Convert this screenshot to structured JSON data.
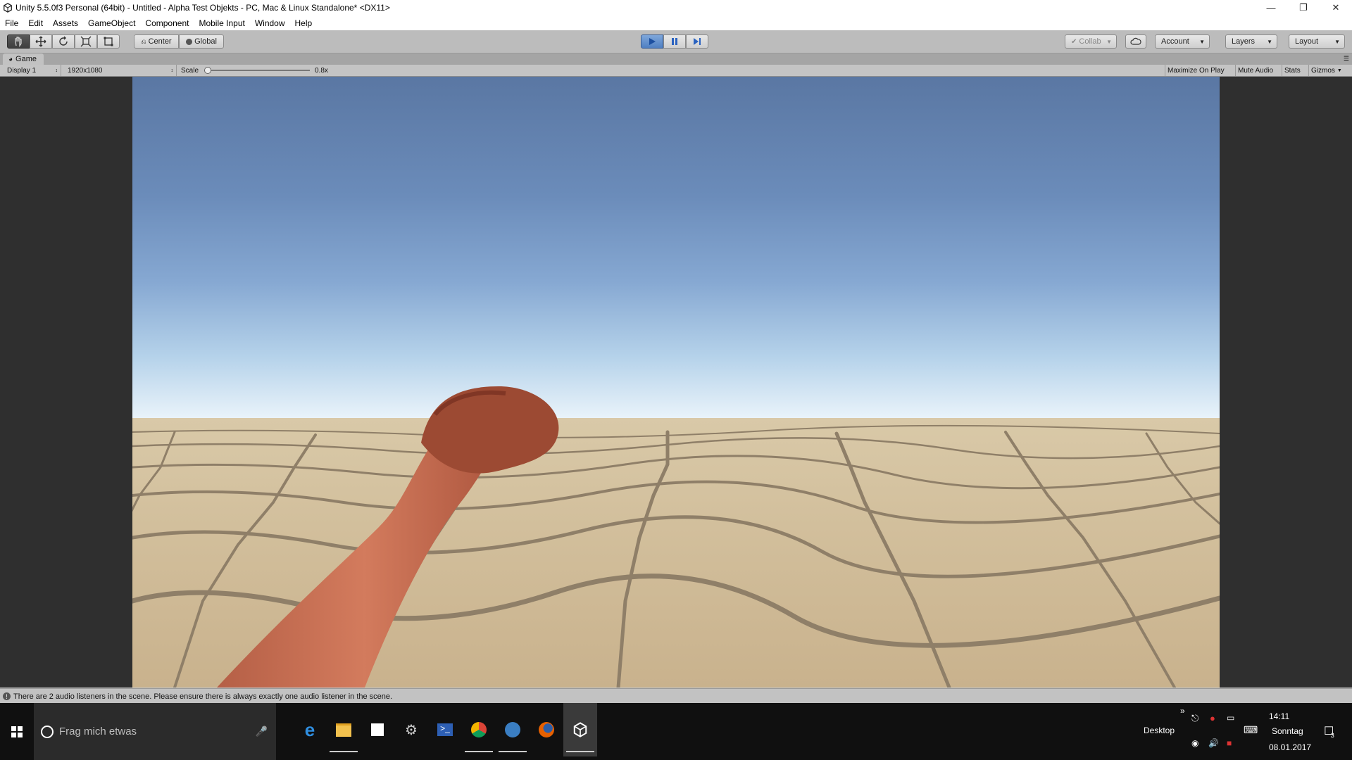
{
  "window": {
    "title": "Unity 5.5.0f3 Personal (64bit) - Untitled - Alpha Test  Objekts - PC, Mac & Linux Standalone* <DX11>",
    "controls": [
      "minimize-icon",
      "restore-icon",
      "close-icon"
    ]
  },
  "menu": {
    "items": [
      "File",
      "Edit",
      "Assets",
      "GameObject",
      "Component",
      "Mobile Input",
      "Window",
      "Help"
    ]
  },
  "toolbar": {
    "tools": [
      "hand-tool-icon",
      "move-tool-icon",
      "rotate-tool-icon",
      "scale-tool-icon",
      "rect-tool-icon"
    ],
    "pivot_label": "Center",
    "space_label": "Global",
    "play_controls": [
      "play-icon",
      "pause-icon",
      "step-icon"
    ],
    "collab_label": "Collab",
    "account_label": "Account",
    "layers_label": "Layers",
    "layout_label": "Layout",
    "play_accent": "#3b82d6"
  },
  "game_panel": {
    "tab_label": "Game",
    "display": "Display 1",
    "resolution": "1920x1080",
    "scale_label": "Scale",
    "scale_value": "0.8x",
    "scale_level": 0.0,
    "toggles": [
      "Maximize On Play",
      "Mute Audio",
      "Stats",
      "Gizmos"
    ]
  },
  "status": {
    "message": "There are 2 audio listeners in the scene. Please ensure there is always exactly one audio listener in the scene."
  },
  "taskbar": {
    "search_placeholder": "Frag mich etwas",
    "apps": [
      "edge-icon",
      "file-explorer-icon",
      "store-icon",
      "tools-icon",
      "powershell-icon",
      "chrome-icon",
      "thunderbird-icon",
      "firefox-icon",
      "unity-icon"
    ],
    "desktop_label": "Desktop",
    "time": "14:11",
    "day": "Sonntag",
    "date": "08.01.2017",
    "notification_count": "3"
  }
}
